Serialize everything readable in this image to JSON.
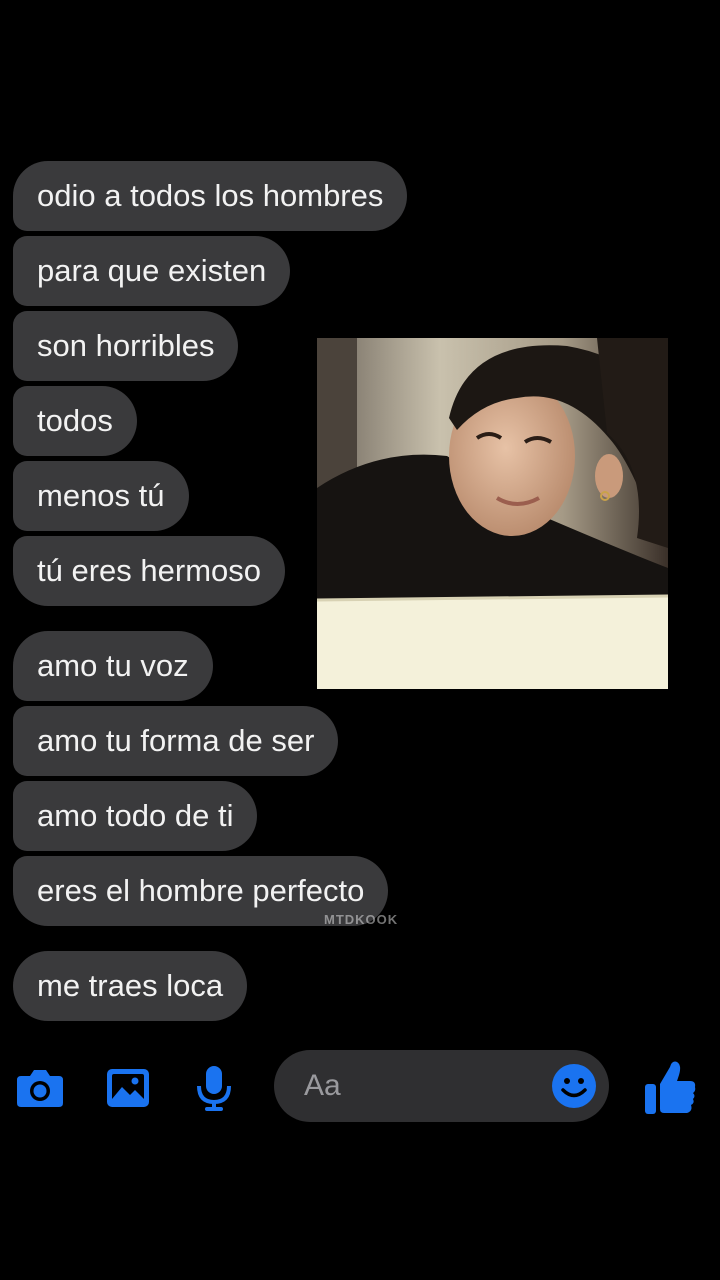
{
  "messages": [
    "odio a todos los hombres",
    "para que existen",
    "son horribles",
    "todos",
    "menos tú",
    "tú eres hermoso",
    "amo tu voz",
    "amo tu forma de ser",
    "amo todo de ti",
    "eres el hombre perfecto",
    "me traes loca"
  ],
  "watermark": "MTDKOOK",
  "composer": {
    "placeholder": "Aa",
    "icons": [
      "camera-icon",
      "gallery-icon",
      "microphone-icon",
      "emoji-icon",
      "thumbs-up-icon"
    ]
  },
  "colors": {
    "background": "#000000",
    "bubble": "#3a3a3c",
    "accent": "#1a73f0"
  }
}
